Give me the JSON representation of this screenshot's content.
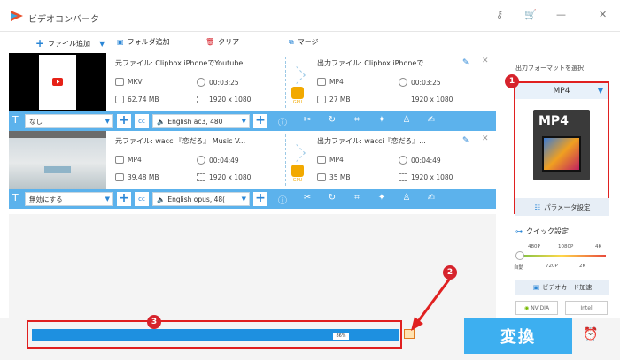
{
  "app": {
    "title": "ビデオコンバータ"
  },
  "toolbar": {
    "add_file": "ファイル追加",
    "add_folder": "フォルダ追加",
    "clear": "クリア",
    "merge": "マージ"
  },
  "files": [
    {
      "src_name": "元ファイル: Clipbox iPhoneでYoutube...",
      "src_format": "MKV",
      "src_duration": "00:03:25",
      "src_size": "62.74 MB",
      "src_resolution": "1920 x 1080",
      "out_name": "出力ファイル: Clipbox iPhoneで...",
      "out_format": "MP4",
      "out_duration": "00:03:25",
      "out_size": "27 MB",
      "out_resolution": "1920 x 1080",
      "subtitle": "なし",
      "audio": "English ac3, 480"
    },
    {
      "src_name": "元ファイル: wacci『恋だろ』 Music V...",
      "src_format": "MP4",
      "src_duration": "00:04:49",
      "src_size": "39.48 MB",
      "src_resolution": "1920 x 1080",
      "out_name": "出力ファイル: wacci『恋だろ』...",
      "out_format": "MP4",
      "out_duration": "00:04:49",
      "out_size": "35 MB",
      "out_resolution": "1920 x 1080",
      "subtitle": "無効にする",
      "audio": "English opus, 48("
    }
  ],
  "gpu_label": "GPU",
  "sidebar": {
    "output_format_title": "出力フォーマットを選択",
    "format": "MP4",
    "param_settings": "パラメータ設定",
    "quick_settings": "クイック設定",
    "q_top": [
      "480P",
      "1080P",
      "4K"
    ],
    "q_bottom": [
      "自動",
      "720P",
      "2K"
    ],
    "gpu_accel": "ビデオカード加速",
    "nvidia": "NVIDIA",
    "intel": "Intel"
  },
  "progress": {
    "percent_label": "86%",
    "value": 0.86
  },
  "convert_label": "変換",
  "badges": [
    "1",
    "2",
    "3"
  ],
  "colors": {
    "accent": "#3daff0",
    "bar": "#5cb2ec",
    "highlight": "#e02020"
  }
}
